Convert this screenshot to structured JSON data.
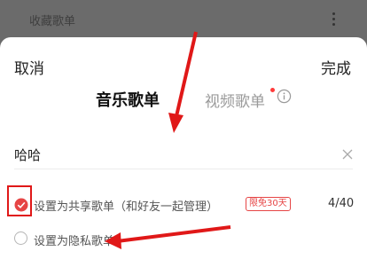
{
  "background": {
    "title": "收藏歌单"
  },
  "sheet": {
    "cancel_label": "取消",
    "done_label": "完成",
    "tabs": [
      {
        "label": "音乐歌单",
        "active": true
      },
      {
        "label": "视频歌单",
        "active": false,
        "has_dot": true
      }
    ],
    "name_value": "哈哈",
    "share_option": {
      "label": "设置为共享歌单（和好友一起管理）",
      "badge": "限免30天",
      "checked": true,
      "count": "4/40"
    },
    "private_option": {
      "label": "设置为隐私歌单",
      "checked": false
    }
  },
  "colors": {
    "accent_red": "#e64545",
    "annotation_red": "#e01818",
    "overlay": "#6a6a6a"
  },
  "icons": [
    "more-vertical-icon",
    "info-icon",
    "clear-icon",
    "check-circle-icon",
    "radio-icon"
  ]
}
